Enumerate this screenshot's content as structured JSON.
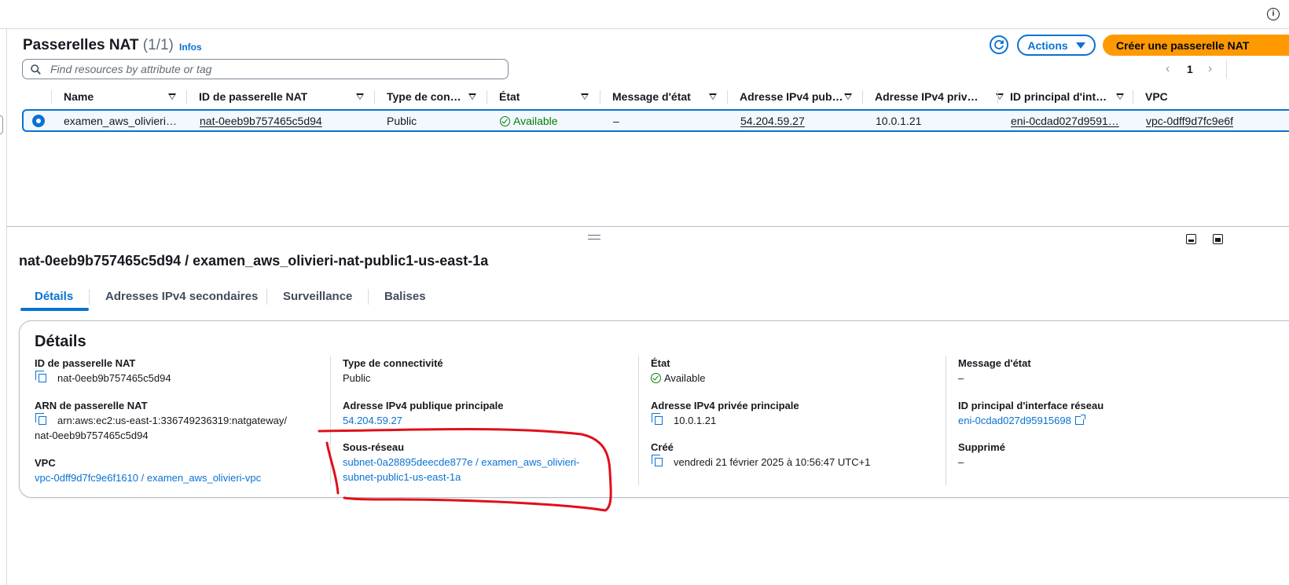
{
  "header": {
    "title": "Passerelles NAT",
    "count": "(1/1)",
    "info_link": "Infos",
    "actions_label": "Actions",
    "create_label": "Créer une passerelle NAT",
    "search_placeholder": "Find resources by attribute or tag"
  },
  "pagination": {
    "prev": "‹",
    "page": "1",
    "next": "›"
  },
  "table": {
    "columns": [
      "Name",
      "ID de passerelle NAT",
      "Type de con…",
      "État",
      "Message d'état",
      "Adresse IPv4 pub…",
      "Adresse IPv4 priv…",
      "ID principal d'int…",
      "VPC"
    ],
    "rows": [
      {
        "name": "examen_aws_olivieri…",
        "nat_id": "nat-0eeb9b757465c5d94",
        "type": "Public",
        "state": "Available",
        "message": "–",
        "public_ip": "54.204.59.27",
        "private_ip": "10.0.1.21",
        "eni": "eni-0cdad027d9591…",
        "vpc": "vpc-0dff9d7fc9e6f"
      }
    ]
  },
  "detail": {
    "title": "nat-0eeb9b757465c5d94 / examen_aws_olivieri-nat-public1-us-east-1a",
    "tabs": [
      "Détails",
      "Adresses IPv4 secondaires",
      "Surveillance",
      "Balises"
    ],
    "card_title": "Détails",
    "fields": {
      "nat_id_label": "ID de passerelle NAT",
      "nat_id_value": "nat-0eeb9b757465c5d94",
      "arn_label": "ARN de passerelle NAT",
      "arn_value_1": "arn:aws:ec2:us-east-1:336749236319:natgateway/",
      "arn_value_2": "nat-0eeb9b757465c5d94",
      "vpc_label": "VPC",
      "vpc_value": "vpc-0dff9d7fc9e6f1610 / examen_aws_olivieri-vpc",
      "conn_type_label": "Type de connectivité",
      "conn_type_value": "Public",
      "public_ip_label": "Adresse IPv4 publique principale",
      "public_ip_value": "54.204.59.27",
      "subnet_label": "Sous-réseau",
      "subnet_value_1": "subnet-0a28895deecde877e / examen_aws_olivieri-",
      "subnet_value_2": "subnet-public1-us-east-1a",
      "state_label": "État",
      "state_value": "Available",
      "private_ip_label": "Adresse IPv4 privée principale",
      "private_ip_value": "10.0.1.21",
      "created_label": "Créé",
      "created_value": "vendredi 21 février 2025 à 10:56:47 UTC+1",
      "message_label": "Message d'état",
      "message_value": "–",
      "eni_label": "ID principal d'interface réseau",
      "eni_value": "eni-0cdad027d95915698",
      "deleted_label": "Supprimé",
      "deleted_value": "–"
    }
  },
  "colors": {
    "link": "#0972d3",
    "primary_button": "#ff9900",
    "success": "#037f0c",
    "annotation": "#e0101a"
  },
  "icons": [
    "info-icon",
    "refresh-icon",
    "caret-down-icon",
    "search-icon",
    "sort-icon",
    "check-circle-icon",
    "copy-icon",
    "external-link-icon",
    "drag-handle-icon",
    "panel-bottom-icon",
    "panel-split-icon"
  ]
}
